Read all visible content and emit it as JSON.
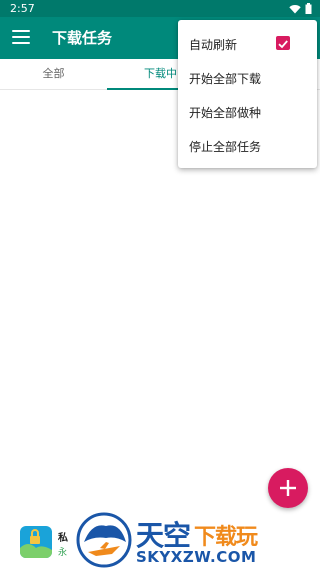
{
  "status_bar": {
    "time": "2:57",
    "icons": [
      "wifi-icon",
      "battery-icon"
    ]
  },
  "app_bar": {
    "title": "下载任务",
    "background_color": "#00897b",
    "menu_icon": "hamburger-menu-icon"
  },
  "tabs": [
    {
      "label": "全部",
      "selected": false
    },
    {
      "label": "下载中",
      "selected": true
    }
  ],
  "overflow_menu": {
    "items": [
      {
        "label": "自动刷新",
        "checked": true
      },
      {
        "label": "开始全部下载"
      },
      {
        "label": "开始全部做种"
      },
      {
        "label": "停止全部任务"
      }
    ]
  },
  "fab": {
    "icon": "plus-icon",
    "color": "#d81b60"
  },
  "bottom_banner": {
    "title": "私",
    "subtitle": "永"
  },
  "watermark": {
    "name_main": "天空",
    "name_accent": "下载玩",
    "url": "SKYXZW.COM"
  },
  "colors": {
    "accent": "#d81b60",
    "primary": "#00897b",
    "primary_dark": "#00796b"
  }
}
